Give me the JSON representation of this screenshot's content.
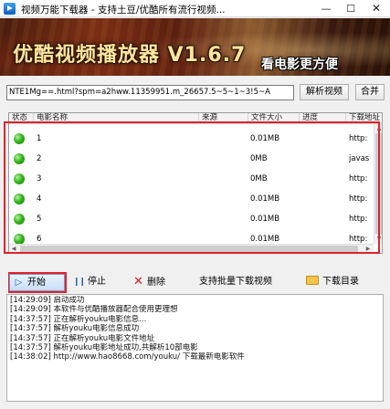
{
  "window": {
    "title": "视频万能下载器 - 支持土豆/优酷所有流行视频...",
    "min_symbol": "—",
    "max_symbol": "☐",
    "close_symbol": "✕"
  },
  "banner": {
    "title": "优酷视频播放器 V1.6.7",
    "slogan": "看电影更方便"
  },
  "url_bar": {
    "value": "NTE1Mg==.html?spm=a2hww.11359951.m_26657.5~5~1~3!5~A",
    "parse_label": "解析视频",
    "merge_label": "合并"
  },
  "table": {
    "columns": [
      "状态",
      "电影名称",
      "来源",
      "文件大小",
      "进度",
      "下载地址"
    ],
    "rows": [
      {
        "num": "1",
        "source": "",
        "size": "0.01MB",
        "progress": "",
        "url": "http:"
      },
      {
        "num": "2",
        "source": "",
        "size": "0MB",
        "progress": "",
        "url": "javas"
      },
      {
        "num": "3",
        "source": "",
        "size": "0MB",
        "progress": "",
        "url": "http:"
      },
      {
        "num": "4",
        "source": "",
        "size": "0.01MB",
        "progress": "",
        "url": "http:"
      },
      {
        "num": "5",
        "source": "",
        "size": "0.01MB",
        "progress": "",
        "url": "http:"
      },
      {
        "num": "6",
        "source": "",
        "size": "0.01MB",
        "progress": "",
        "url": "http:"
      }
    ]
  },
  "toolbar": {
    "start": "开始",
    "stop": "停止",
    "delete": "删除",
    "batch": "支持批量下载视频",
    "download_dir": "下载目录",
    "play_icon": "▷",
    "pause_icon": "❙❙",
    "delete_icon": "✕"
  },
  "log": [
    "[14:29:09] 启动成功",
    "[14:29:09] 本软件与优酷播放器配合使用更理想",
    "[14:37:57] 正在解析youku电影信息...",
    "[14:37:57] 解析youku电影信息成功",
    "[14:37:57] 正在解析youku电影文件地址",
    "[14:37:57] 解析youku电影地址成功,共解析10部电影",
    "[14:38:02] http://www.hao8668.com/youku/ 下载最新电影软件"
  ],
  "colors": {
    "highlight_red": "#e0222a",
    "status_green": "#36b51e"
  }
}
